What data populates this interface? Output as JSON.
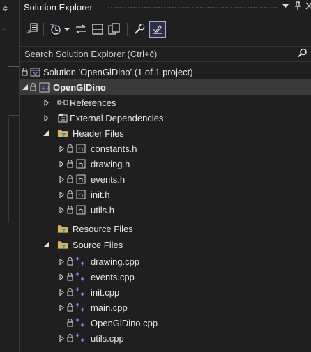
{
  "panel": {
    "title": "Solution Explorer",
    "pin_glyph": "p",
    "close_glyph": "X"
  },
  "search": {
    "placeholder": "Search Solution Explorer (Ctrl+č)"
  },
  "tree": {
    "solution": "Solution 'OpenGlDino' (1 of 1 project)",
    "project": "OpenGlDino",
    "references": "References",
    "external_dependencies": "External Dependencies",
    "header_files": "Header Files",
    "headers": [
      "constants.h",
      "drawing.h",
      "events.h",
      "init.h",
      "utils.h"
    ],
    "resource_files": "Resource Files",
    "source_files": "Source Files",
    "sources": [
      "drawing.cpp",
      "events.cpp",
      "init.cpp",
      "main.cpp",
      "OpenGlDino.cpp",
      "utils.cpp"
    ]
  },
  "colors": {
    "background": "#1f1f1f",
    "selection": "#3a3a3a",
    "folder": "#d9b25c",
    "cpp_plus": "#b06ce6",
    "header_icon": "#d0d0d0",
    "active_tool_border": "#a9a9e8"
  },
  "icons": {
    "toolbar": [
      "sync-with-active-doc-icon",
      "history-icon",
      "back-forward-icon",
      "collapse-all-icon",
      "show-all-files-icon",
      "properties-wrench-icon",
      "preview-selected-icon"
    ]
  }
}
